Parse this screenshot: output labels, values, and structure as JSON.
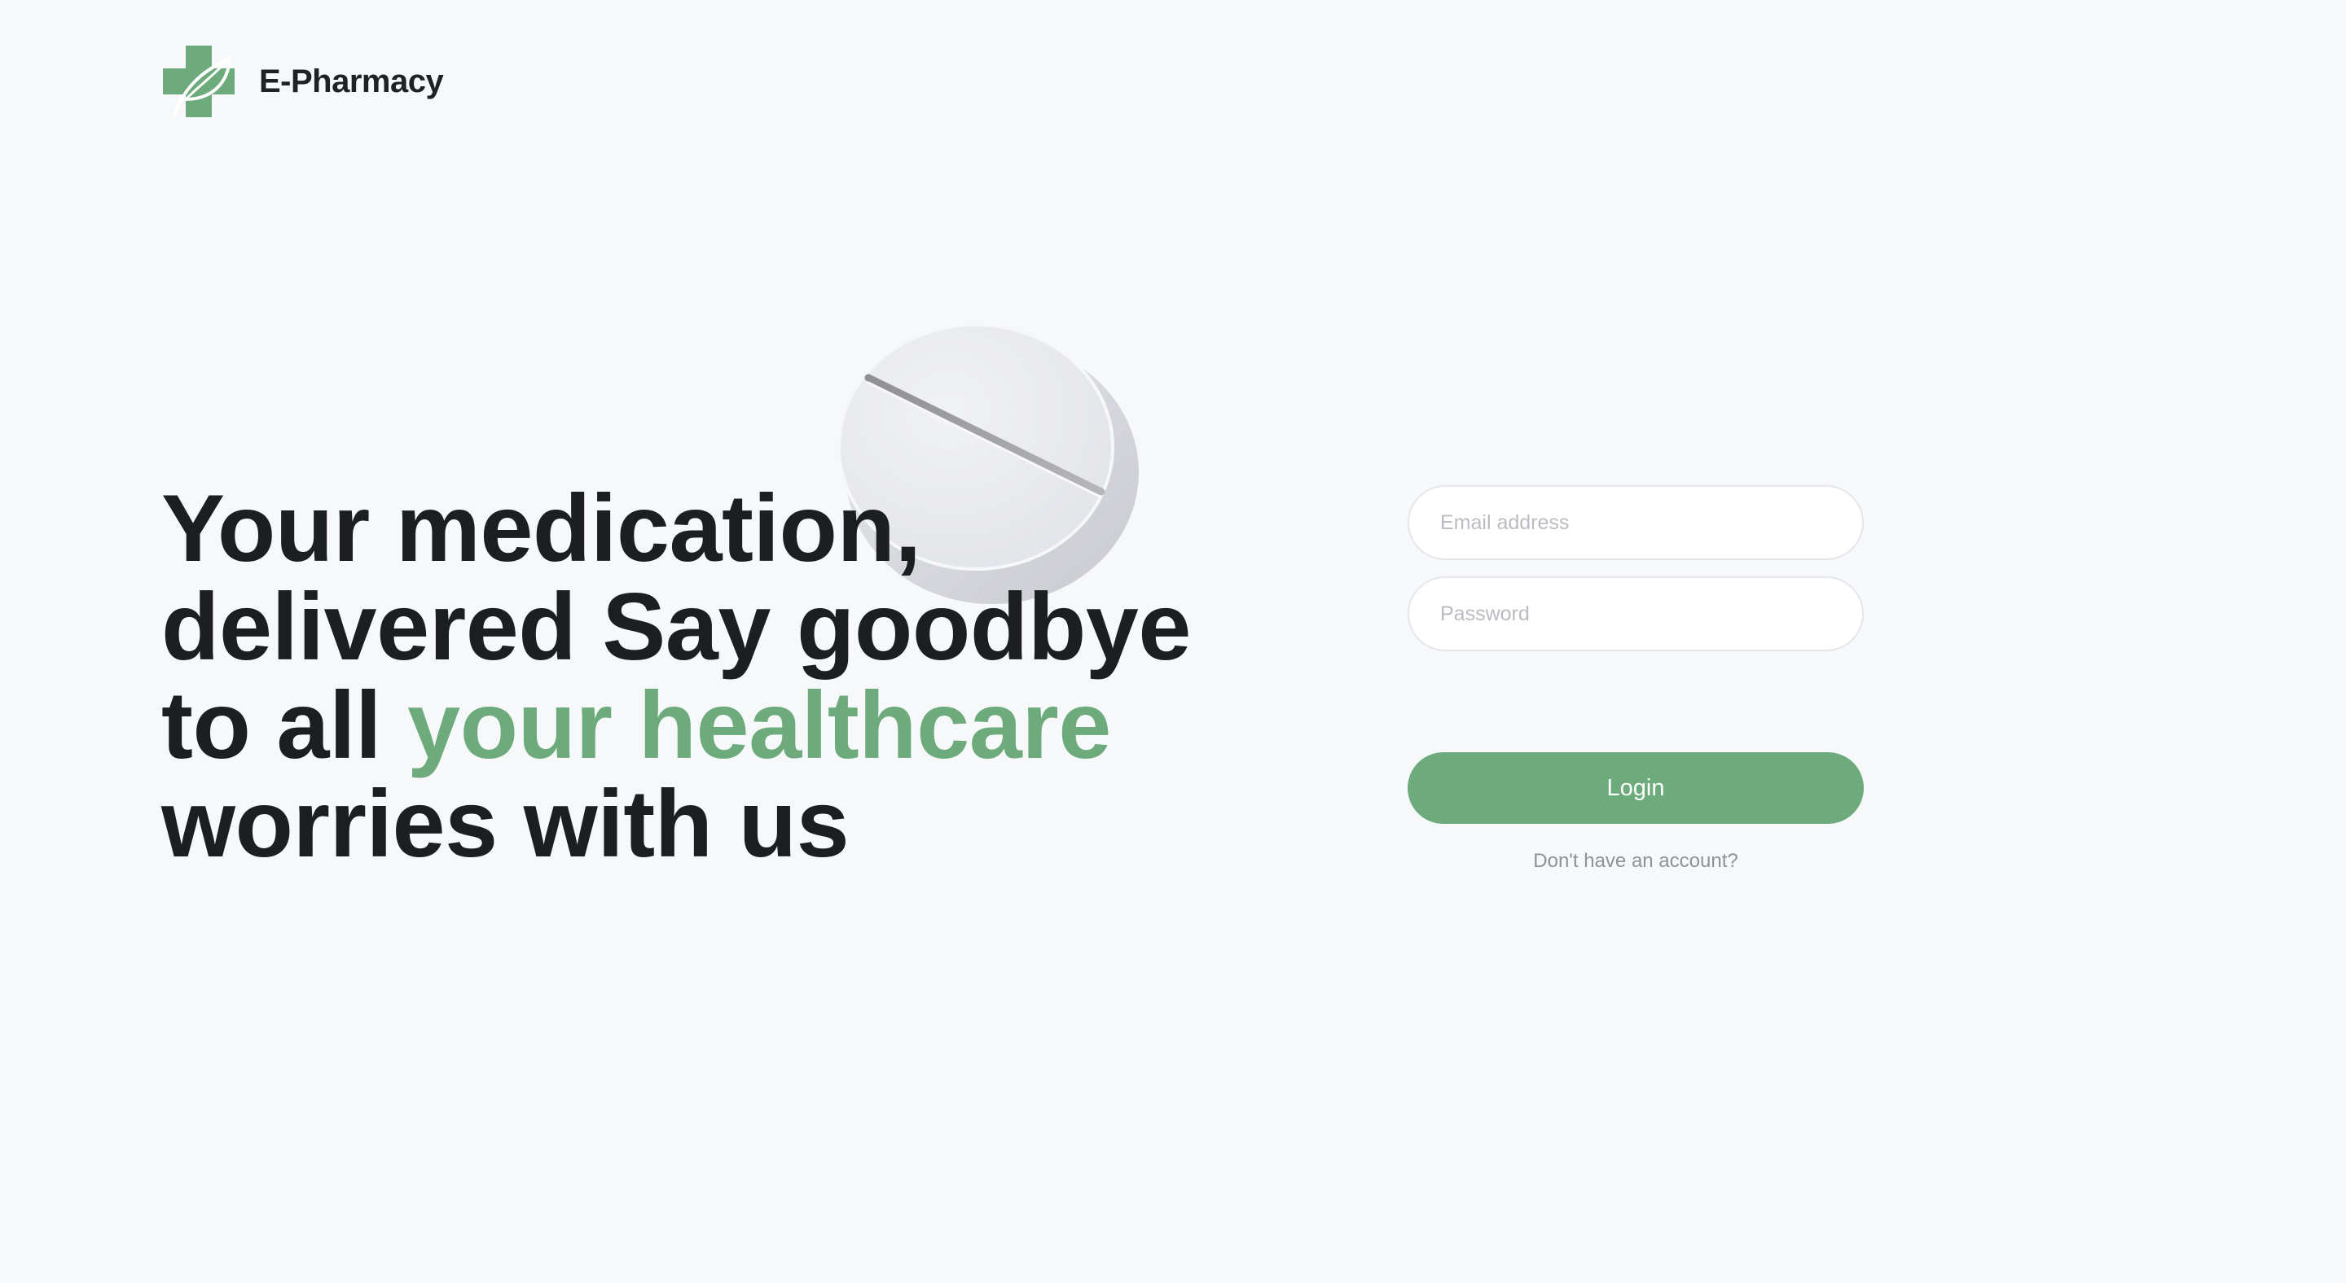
{
  "brand": {
    "name": "E-Pharmacy",
    "logo_icon": "leaf-cross-icon",
    "logo_color": "#6dab7c"
  },
  "hero": {
    "line1": "Your medication,",
    "line2": "delivered Say goodbye",
    "line3_plain": "to all ",
    "line3_accent": "your healthcare",
    "line4": "worries with us",
    "accent_color": "#6dab7c",
    "image": "pill-tablet-image"
  },
  "login_form": {
    "email_placeholder": "Email address",
    "password_placeholder": "Password",
    "login_label": "Login",
    "signup_text": "Don't have an account?",
    "button_color": "#6dab7c"
  }
}
